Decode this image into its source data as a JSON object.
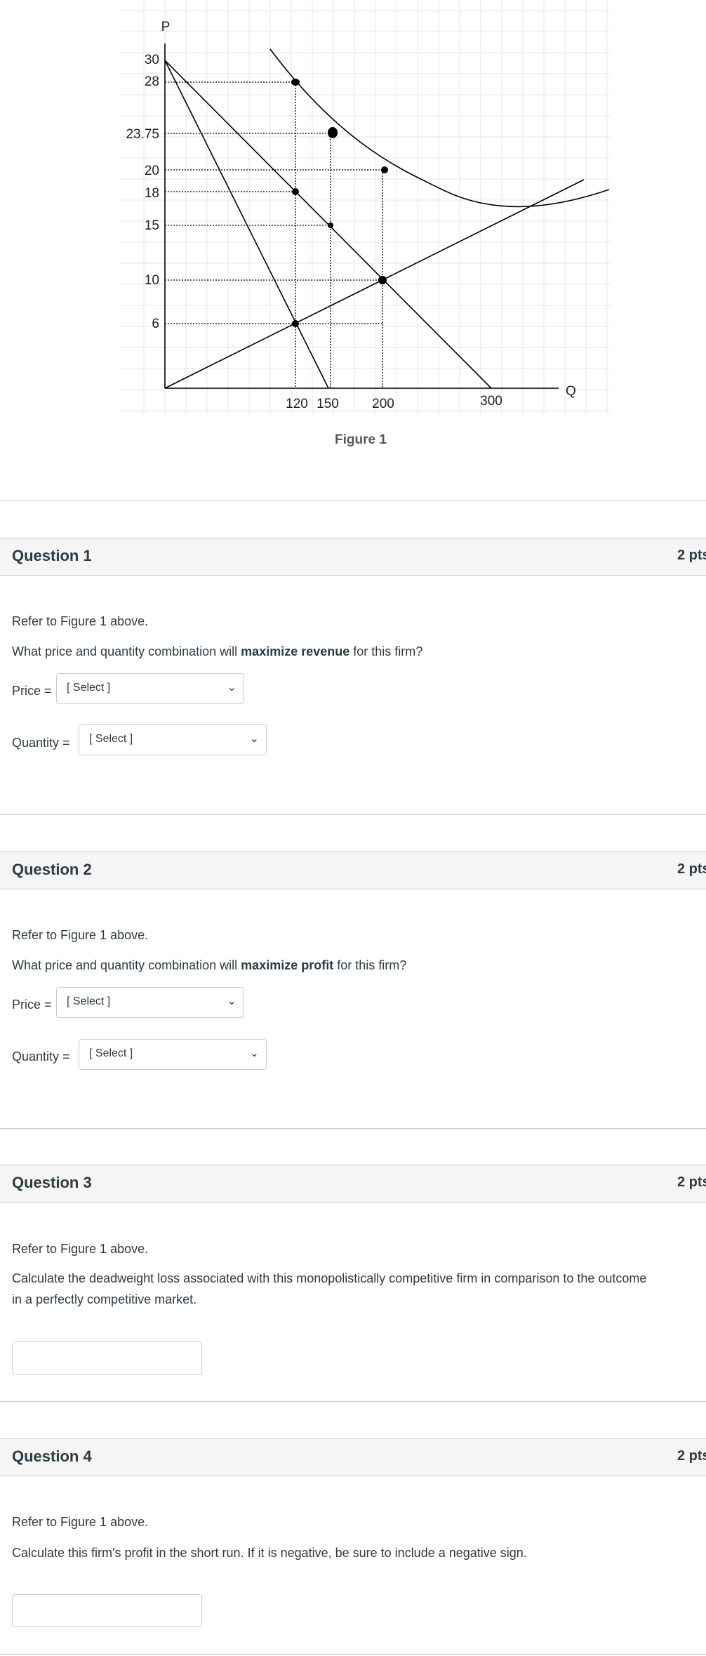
{
  "figure": {
    "caption": "Figure 1",
    "axis_p": "P",
    "axis_q": "Q",
    "y_ticks": [
      "30",
      "28",
      "23.75",
      "20",
      "18",
      "15",
      "10",
      "6"
    ],
    "x_ticks": [
      "120",
      "150",
      "200",
      "300"
    ]
  },
  "questions": [
    {
      "title": "Question 1",
      "points": "2 pts",
      "intro": "Refer to Figure 1 above.",
      "prompt_before": "What price and quantity combination will ",
      "prompt_bold": "maximize revenue",
      "prompt_after": " for this firm?",
      "price_label": "Price =",
      "price_select": "[ Select ]",
      "quantity_label": "Quantity =",
      "quantity_select": "[ Select ]"
    },
    {
      "title": "Question 2",
      "points": "2 pts",
      "intro": "Refer to Figure 1 above.",
      "prompt_before": "What price and quantity combination will ",
      "prompt_bold": "maximize profit",
      "prompt_after": " for this firm?",
      "price_label": "Price =",
      "price_select": "[ Select ]",
      "quantity_label": "Quantity =",
      "quantity_select": "[ Select ]"
    },
    {
      "title": "Question 3",
      "points": "2 pts",
      "intro": "Refer to Figure 1 above.",
      "prompt_line1": "Calculate the deadweight loss associated with this monopolistically competitive firm in comparison to the outcome",
      "prompt_line2": "in a perfectly competitive market.",
      "answer_value": ""
    },
    {
      "title": "Question 4",
      "points": "2 pts",
      "intro": "Refer to Figure 1 above.",
      "prompt": "Calculate this firm's profit in the short run. If it is negative, be sure to include a negative sign.",
      "answer_value": ""
    }
  ],
  "icons": {
    "dropdown": "chevron-down-icon"
  },
  "colors": {
    "header_bg": "#f5f5f5",
    "border": "#c7cdd1",
    "text": "#2d3b45"
  }
}
